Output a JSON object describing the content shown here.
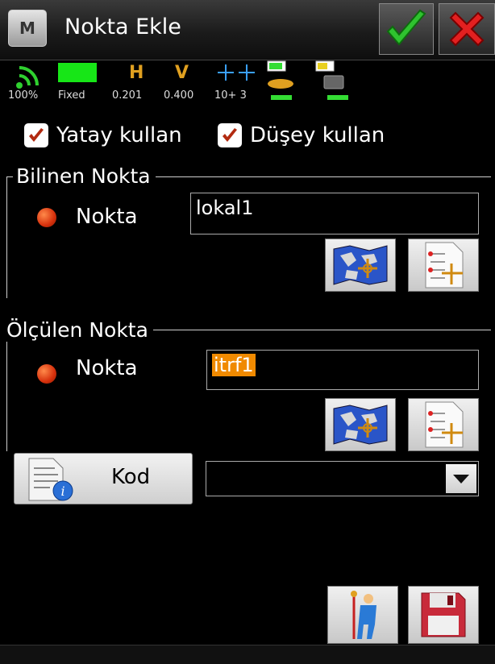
{
  "titlebar": {
    "menu_label": "M",
    "title": "Nokta Ekle",
    "ok_icon": "checkmark-icon",
    "cancel_icon": "close-icon"
  },
  "status": {
    "signal_value": "100%",
    "fix_value": "Fixed",
    "h_label": "H",
    "h_value": "0.201",
    "v_label": "V",
    "v_value": "0.400",
    "sats_value": "10+ 3",
    "accent_green": "#17e617",
    "accent_orange": "#e0a020"
  },
  "options": {
    "yatay_label": "Yatay kullan",
    "yatay_checked": true,
    "dusey_label": "Düşey kullan",
    "dusey_checked": true
  },
  "known_point": {
    "group_title": "Bilinen Nokta",
    "field_label": "Nokta",
    "field_value": "lokal1",
    "map_icon": "map-icon",
    "list_icon": "point-list-icon"
  },
  "measured_point": {
    "group_title": "Ölçülen Nokta",
    "field_label": "Nokta",
    "field_value": "itrf1",
    "map_icon": "map-icon",
    "list_icon": "point-list-icon"
  },
  "code": {
    "button_label": "Kod",
    "dropdown_value": ""
  },
  "footer": {
    "measure_icon": "surveyor-icon",
    "save_icon": "save-icon"
  }
}
